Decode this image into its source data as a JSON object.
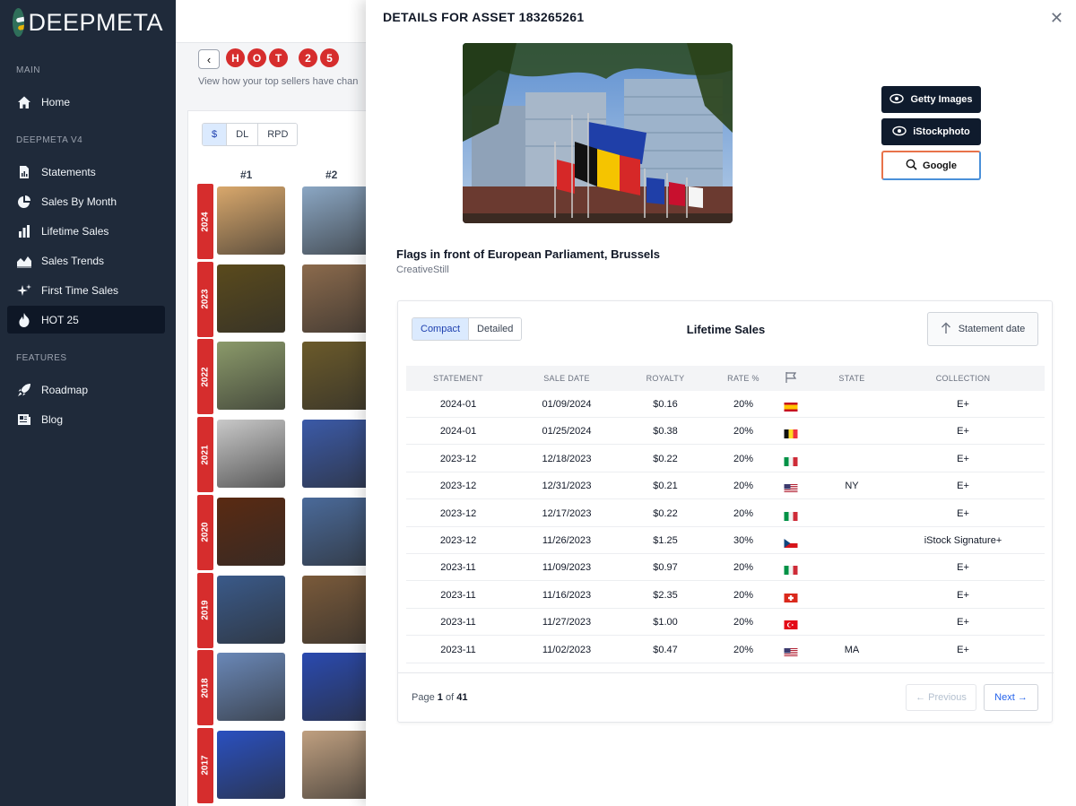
{
  "brand": {
    "name": "DEEPMETA"
  },
  "sidebar": {
    "sections": [
      {
        "title": "MAIN",
        "items": [
          {
            "label": "Home",
            "icon": "home-icon"
          }
        ]
      },
      {
        "title": "DEEPMETA V4",
        "items": [
          {
            "label": "Statements",
            "icon": "document-icon"
          },
          {
            "label": "Sales By Month",
            "icon": "pie-chart-icon"
          },
          {
            "label": "Lifetime Sales",
            "icon": "bar-chart-icon"
          },
          {
            "label": "Sales Trends",
            "icon": "area-chart-icon"
          },
          {
            "label": "First Time Sales",
            "icon": "sparkles-icon"
          },
          {
            "label": "HOT 25",
            "icon": "fire-icon",
            "active": true
          }
        ]
      },
      {
        "title": "FEATURES",
        "items": [
          {
            "label": "Roadmap",
            "icon": "rocket-icon"
          },
          {
            "label": "Blog",
            "icon": "newspaper-icon"
          }
        ]
      }
    ]
  },
  "background": {
    "hot_letters": [
      "H",
      "O",
      "T",
      "2",
      "5"
    ],
    "subtitle": "View how your top sellers have chan",
    "metric_tabs": [
      "$",
      "DL",
      "RPD"
    ],
    "ranks": [
      "#1",
      "#2"
    ],
    "years": [
      "2024",
      "2023",
      "2022",
      "2021",
      "2020",
      "2019",
      "2018",
      "2017"
    ]
  },
  "modal": {
    "title": "DETAILS FOR ASSET 183265261",
    "close_icon": "close-icon",
    "buttons": {
      "getty": "Getty Images",
      "istock": "iStockphoto",
      "google": "Google"
    },
    "asset": {
      "title": "Flags in front of European Parliament, Brussels",
      "author": "CreativeStill"
    },
    "sales": {
      "view_tabs": [
        "Compact",
        "Detailed"
      ],
      "title": "Lifetime Sales",
      "sort_label": "Statement date",
      "columns": [
        "STATEMENT",
        "SALE DATE",
        "ROYALTY",
        "RATE %",
        "",
        "STATE",
        "COLLECTION"
      ],
      "rows": [
        {
          "statement": "2024-01",
          "sale_date": "01/09/2024",
          "royalty": "$0.16",
          "rate": "20%",
          "flag": "es",
          "state": "",
          "collection": "E+"
        },
        {
          "statement": "2024-01",
          "sale_date": "01/25/2024",
          "royalty": "$0.38",
          "rate": "20%",
          "flag": "be",
          "state": "",
          "collection": "E+"
        },
        {
          "statement": "2023-12",
          "sale_date": "12/18/2023",
          "royalty": "$0.22",
          "rate": "20%",
          "flag": "it",
          "state": "",
          "collection": "E+"
        },
        {
          "statement": "2023-12",
          "sale_date": "12/31/2023",
          "royalty": "$0.21",
          "rate": "20%",
          "flag": "us",
          "state": "NY",
          "collection": "E+"
        },
        {
          "statement": "2023-12",
          "sale_date": "12/17/2023",
          "royalty": "$0.22",
          "rate": "20%",
          "flag": "it",
          "state": "",
          "collection": "E+"
        },
        {
          "statement": "2023-12",
          "sale_date": "11/26/2023",
          "royalty": "$1.25",
          "rate": "30%",
          "flag": "cz",
          "state": "",
          "collection": "iStock Signature+"
        },
        {
          "statement": "2023-11",
          "sale_date": "11/09/2023",
          "royalty": "$0.97",
          "rate": "20%",
          "flag": "it",
          "state": "",
          "collection": "E+"
        },
        {
          "statement": "2023-11",
          "sale_date": "11/16/2023",
          "royalty": "$2.35",
          "rate": "20%",
          "flag": "ch",
          "state": "",
          "collection": "E+"
        },
        {
          "statement": "2023-11",
          "sale_date": "11/27/2023",
          "royalty": "$1.00",
          "rate": "20%",
          "flag": "tr",
          "state": "",
          "collection": "E+"
        },
        {
          "statement": "2023-11",
          "sale_date": "11/02/2023",
          "royalty": "$0.47",
          "rate": "20%",
          "flag": "us",
          "state": "MA",
          "collection": "E+"
        }
      ],
      "pager": {
        "page_word": "Page",
        "current": "1",
        "of_word": "of",
        "total": "41",
        "previous": "← Previous",
        "next": "Next →"
      }
    }
  }
}
